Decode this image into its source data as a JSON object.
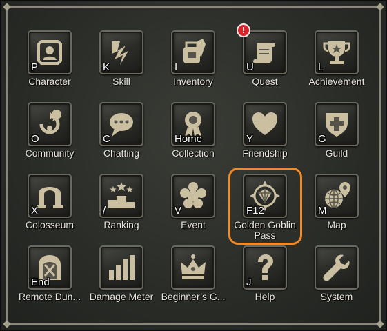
{
  "menu": {
    "row1": [
      {
        "key": "P",
        "label": "Character",
        "icon": "character-portrait-icon"
      },
      {
        "key": "K",
        "label": "Skill",
        "icon": "skill-lightning-icon"
      },
      {
        "key": "I",
        "label": "Inventory",
        "icon": "inventory-bag-icon"
      },
      {
        "key": "U",
        "label": "Quest",
        "icon": "quest-scroll-icon"
      },
      {
        "key": "L",
        "label": "Achievement",
        "icon": "achievement-trophy-icon"
      }
    ],
    "row2": [
      {
        "key": "O",
        "label": "Community",
        "icon": "community-chat-cycle-icon"
      },
      {
        "key": "C",
        "label": "Chatting",
        "icon": "chatting-bubble-icon"
      },
      {
        "key": "Home",
        "label": "Collection",
        "icon": "collection-medal-icon"
      },
      {
        "key": "Y",
        "label": "Friendship",
        "icon": "friendship-heart-icon"
      },
      {
        "key": "G",
        "label": "Guild",
        "icon": "guild-shield-icon"
      }
    ],
    "row3": [
      {
        "key": "X",
        "label": "Colosseum",
        "icon": "colosseum-arch-icon"
      },
      {
        "key": "/",
        "label": "Ranking",
        "icon": "ranking-podium-icon"
      },
      {
        "key": "V",
        "label": "Event",
        "icon": "event-flower-icon"
      },
      {
        "key": "F12",
        "label": "Golden Goblin Pass",
        "icon": "golden-goblin-pass-emblem-icon"
      },
      {
        "key": "M",
        "label": "Map",
        "icon": "map-globe-pin-icon"
      }
    ],
    "row4": [
      {
        "key": "End",
        "label": "Remote Dun...",
        "icon": "remote-dungeon-door-icon"
      },
      {
        "key": "",
        "label": "Damage Meter",
        "icon": "damage-meter-bars-icon"
      },
      {
        "key": "",
        "label": "Beginner’s G...",
        "icon": "beginners-guide-crown-icon"
      },
      {
        "key": "J",
        "label": "Help",
        "icon": "help-question-icon"
      },
      {
        "key": "",
        "label": "System",
        "icon": "system-wrench-icon"
      }
    ]
  },
  "quest_alert_symbol": "!",
  "colors": {
    "highlight": "#f08a2a",
    "icon": "#cbbfa2",
    "alert": "#d9232a"
  }
}
